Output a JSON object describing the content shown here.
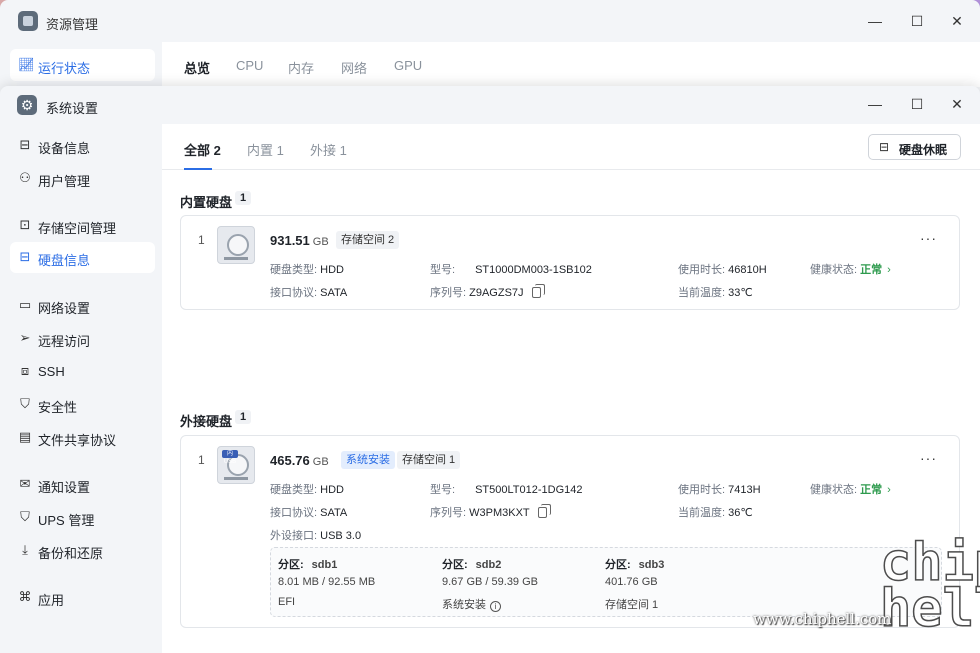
{
  "bg_window": {
    "title": "资源管理",
    "nav_item": "运行状态",
    "tabs": [
      "总览",
      "CPU",
      "内存",
      "网络",
      "GPU"
    ]
  },
  "window": {
    "title": "系统设置",
    "controls": {
      "minimize": "—",
      "maximize": "☐",
      "close": "✕"
    }
  },
  "sidebar": {
    "items": [
      {
        "label": "设备信息",
        "icon": "drive-icon"
      },
      {
        "label": "用户管理",
        "icon": "users-icon"
      },
      {
        "label": "存储空间管理",
        "icon": "storage-icon"
      },
      {
        "label": "硬盘信息",
        "icon": "disk-icon",
        "active": true
      },
      {
        "label": "网络设置",
        "icon": "network-icon"
      },
      {
        "label": "远程访问",
        "icon": "send-icon"
      },
      {
        "label": "SSH",
        "icon": "terminal-icon"
      },
      {
        "label": "安全性",
        "icon": "shield-icon"
      },
      {
        "label": "文件共享协议",
        "icon": "file-icon"
      },
      {
        "label": "通知设置",
        "icon": "mail-icon"
      },
      {
        "label": "UPS 管理",
        "icon": "power-icon"
      },
      {
        "label": "备份和还原",
        "icon": "backup-icon"
      },
      {
        "label": "应用",
        "icon": "apps-icon"
      }
    ]
  },
  "main": {
    "tabs": [
      {
        "label": "全部 2",
        "active": true
      },
      {
        "label": "内置 1"
      },
      {
        "label": "外接 1"
      }
    ],
    "sleep_button": "硬盘休眠",
    "internal": {
      "title": "内置硬盘",
      "count": "1",
      "disk": {
        "index": "1",
        "capacity": "931.51",
        "unit": "GB",
        "badges": [
          "存储空间 2"
        ],
        "type_label": "硬盘类型:",
        "type": "HDD",
        "model_label": "型号:",
        "model": "ST1000DM003-1SB102",
        "hours_label": "使用时长:",
        "hours": "46810H",
        "health_label": "健康状态:",
        "health": "正常",
        "iface_label": "接口协议:",
        "iface": "SATA",
        "serial_label": "序列号:",
        "serial": "Z9AGZS7J",
        "temp_label": "当前温度:",
        "temp": "33℃"
      }
    },
    "external": {
      "title": "外接硬盘",
      "count": "1",
      "disk": {
        "index": "1",
        "icon_tag": "内USB",
        "capacity": "465.76",
        "unit": "GB",
        "badges": [
          "系统安装",
          "存储空间 1"
        ],
        "type_label": "硬盘类型:",
        "type": "HDD",
        "model_label": "型号:",
        "model": "ST500LT012-1DG142",
        "hours_label": "使用时长:",
        "hours": "7413H",
        "health_label": "健康状态:",
        "health": "正常",
        "iface_label": "接口协议:",
        "iface": "SATA",
        "serial_label": "序列号:",
        "serial": "W3PM3KXT",
        "temp_label": "当前温度:",
        "temp": "36℃",
        "port_label": "外设接口:",
        "port": "USB 3.0",
        "partitions": [
          {
            "label": "分区:",
            "name": "sdb1",
            "usage": "8.01 MB / 92.55 MB",
            "fs": "EFI"
          },
          {
            "label": "分区:",
            "name": "sdb2",
            "usage": "9.67 GB / 59.39 GB",
            "fs": "系统安装"
          },
          {
            "label": "分区:",
            "name": "sdb3",
            "usage": "401.76 GB",
            "fs": "存储空间 1"
          }
        ]
      }
    }
  },
  "watermark": {
    "url": "www.chiphell.com",
    "logo": "chip hell"
  },
  "colors": {
    "accent": "#2b6de5",
    "ok": "#2e9b4e"
  }
}
